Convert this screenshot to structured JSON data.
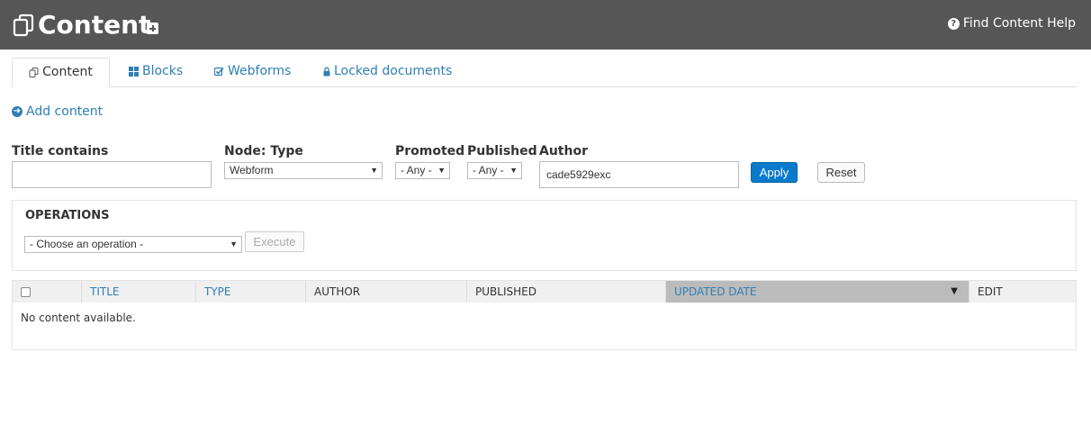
{
  "header": {
    "title": "Content",
    "icons": {
      "title_icon": "content-pages-icon",
      "add_icon": "plus-square-icon",
      "help_icon": "question-circle-icon"
    },
    "help_label": "Find Content Help"
  },
  "tabs": [
    {
      "label": "Content",
      "icon": "content-pages-icon",
      "active": true
    },
    {
      "label": "Blocks",
      "icon": "blocks-grid-icon"
    },
    {
      "label": "Webforms",
      "icon": "check-square-icon"
    },
    {
      "label": "Locked documents",
      "icon": "lock-icon"
    }
  ],
  "add_content": {
    "label": "Add content",
    "icon": "arrow-circle-right-icon"
  },
  "filters": {
    "title_contains": {
      "label": "Title contains",
      "value": ""
    },
    "node_type": {
      "label": "Node: Type",
      "selected": "Webform"
    },
    "promoted": {
      "label": "Promoted",
      "selected": "- Any -"
    },
    "published": {
      "label": "Published",
      "selected": "- Any -"
    },
    "author": {
      "label": "Author",
      "value": "cade5929exc"
    },
    "apply_label": "Apply",
    "reset_label": "Reset"
  },
  "operations": {
    "title": "OPERATIONS",
    "selected": "- Choose an operation -",
    "execute_label": "Execute"
  },
  "table": {
    "columns": [
      "TITLE",
      "TYPE",
      "AUTHOR",
      "PUBLISHED",
      "UPDATED DATE",
      "EDIT"
    ],
    "sorted_column": "UPDATED DATE",
    "empty_text": "No content available."
  },
  "colors": {
    "header_bg": "#565656",
    "link": "#2e7fb5",
    "apply_bg": "#0a7acc",
    "sorted_header_bg": "#bbbbbb"
  }
}
